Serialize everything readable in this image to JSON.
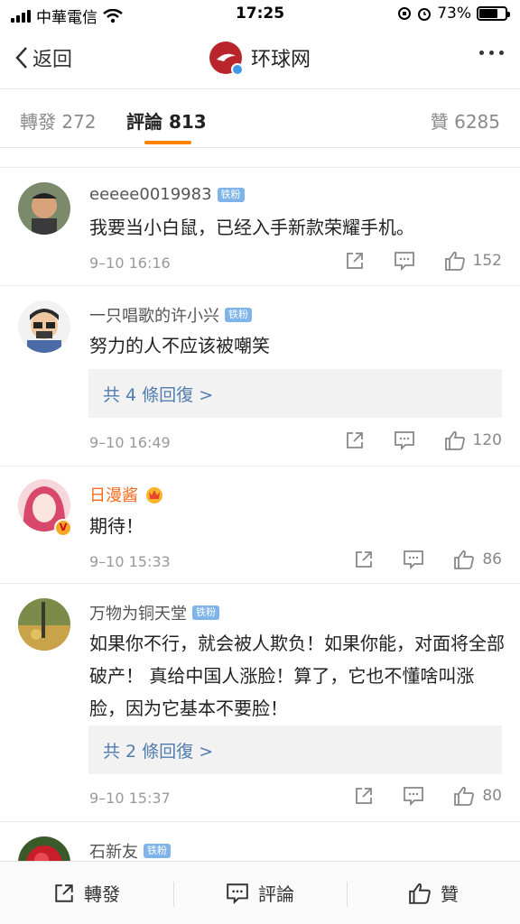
{
  "status_bar": {
    "carrier": "中華電信",
    "time": "17:25",
    "battery": "73%",
    "battery_level": 0.73
  },
  "nav": {
    "back_label": "返回",
    "title": "环球网"
  },
  "tabs": {
    "repost": "轉發 272",
    "comment": "評論 813",
    "like": "贊 6285"
  },
  "comments": [
    {
      "name": "eeeee0019983",
      "badge": "铁粉",
      "text": "我要当小白鼠，已经入手新款荣耀手机。",
      "time": "9–10 16:16",
      "likes": "152"
    },
    {
      "name": "一只唱歌的许小兴",
      "badge": "铁粉",
      "text": "努力的人不应该被嘲笑",
      "replies": "共 4 條回復 >",
      "time": "9–10 16:49",
      "likes": "120"
    },
    {
      "name": "日漫酱",
      "text": "期待！",
      "time": "9–10 15:33",
      "likes": "86"
    },
    {
      "name": "万物为铜天堂",
      "badge": "铁粉",
      "text": "如果你不行，就会被人欺负！如果你能，对面将全部破产！ 真给中国人涨脸！算了，它也不懂啥叫涨脸，因为它基本不要脸！",
      "replies": "共 2 條回復 >",
      "time": "9–10 15:37",
      "likes": "80"
    },
    {
      "name": "石新友",
      "badge": "铁粉"
    }
  ],
  "bottom_bar": {
    "repost": "轉發",
    "comment": "評論",
    "like": "贊"
  },
  "colors": {
    "accent": "#ff8200",
    "link": "#507daf",
    "badge": "#7eb4ea",
    "vip_name": "#f86b1d"
  },
  "icons": [
    "share-icon",
    "comment-icon",
    "like-icon",
    "back-chevron-icon",
    "more-icon",
    "wifi-icon",
    "alarm-icon"
  ]
}
